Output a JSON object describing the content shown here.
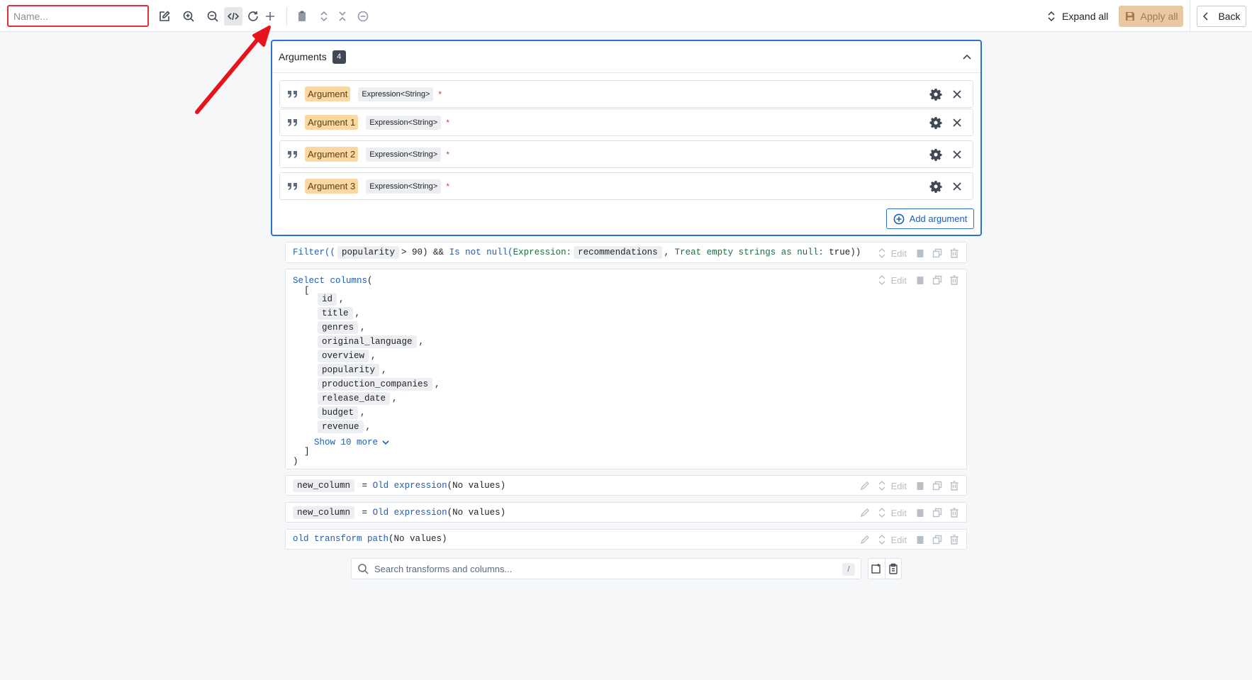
{
  "toolbar": {
    "name_placeholder": "Name...",
    "icons": [
      "edit-icon",
      "zoom-in-icon",
      "zoom-out-icon",
      "code-icon",
      "refresh-icon",
      "plus-icon",
      "clipboard-icon",
      "expand-icon",
      "collapse-icon",
      "minus-circle-icon"
    ],
    "expand_all_label": "Expand all",
    "apply_all_label": "Apply all",
    "back_label": "Back"
  },
  "arguments": {
    "title": "Arguments",
    "count": "4",
    "items": [
      {
        "name": "Argument",
        "type": "Expression<String>",
        "required": "*"
      },
      {
        "name": "Argument 1",
        "type": "Expression<String>",
        "required": "*"
      },
      {
        "name": "Argument 2",
        "type": "Expression<String>",
        "required": "*"
      },
      {
        "name": "Argument 3",
        "type": "Expression<String>",
        "required": "*"
      }
    ],
    "add_label": "Add argument"
  },
  "transforms": {
    "edit_label": "Edit",
    "filter": {
      "fn": "Filter((",
      "col1": "popularity",
      "op": "> 90) &&",
      "fn2": "Is not null",
      "paren": "(",
      "param1": "Expression:",
      "col2": "recommendations",
      "comma": ",",
      "param2": "Treat empty strings as null:",
      "value": "true))"
    },
    "select": {
      "fn": "Select columns",
      "open": "(",
      "bracket_open": "[",
      "columns": [
        "id",
        "title",
        "genres",
        "original_language",
        "overview",
        "popularity",
        "production_companies",
        "release_date",
        "budget",
        "revenue"
      ],
      "separator": ",",
      "show_more": "Show 10 more",
      "bracket_close": "]",
      "close": ")"
    },
    "new_col_1": {
      "col": "new_column",
      "eq": "=",
      "fn": "Old expression",
      "args": "(No values)"
    },
    "new_col_2": {
      "col": "new_column",
      "eq": "=",
      "fn": "Old expression",
      "args": "(No values)"
    },
    "old_path": {
      "fn": "old transform path",
      "args": "(No values)"
    }
  },
  "search": {
    "placeholder": "Search transforms and columns...",
    "shortcut": "/"
  },
  "colors": {
    "accent": "#2d72d2",
    "error_border": "#e0303d",
    "argument_tag": "#fbd7a1",
    "apply_button": "#e8c9a4",
    "annotation_arrow": "#e8141c"
  }
}
